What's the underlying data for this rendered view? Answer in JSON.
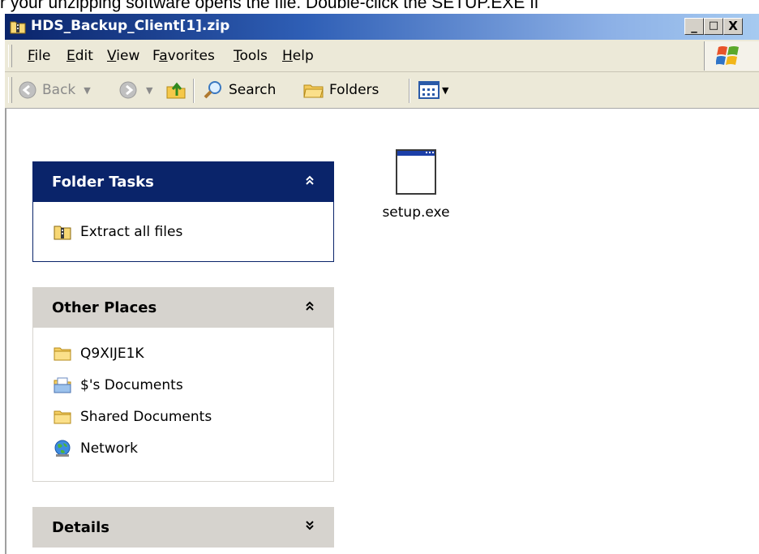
{
  "caption": "r your unzipping software opens the file. Double-click the SETUP.EXE fi",
  "window": {
    "title": "HDS_Backup_Client[1].zip",
    "controls": {
      "minimize": "_",
      "maximize": "□",
      "close": "X"
    }
  },
  "menu": {
    "items": [
      {
        "label": "File",
        "u": "F",
        "rest": "ile"
      },
      {
        "label": "Edit",
        "u": "E",
        "rest": "dit"
      },
      {
        "label": "View",
        "u": "V",
        "rest": "iew"
      },
      {
        "label": "Favorites",
        "pre": "F",
        "u": "a",
        "rest": "vorites"
      },
      {
        "label": "Tools",
        "u": "T",
        "rest": "ools"
      },
      {
        "label": "Help",
        "u": "H",
        "rest": "elp"
      }
    ]
  },
  "toolbar": {
    "back": "Back",
    "search": "Search",
    "folders": "Folders"
  },
  "folder_tasks": {
    "title": "Folder Tasks",
    "collapse_glyph": "⌃",
    "items": [
      "Extract all files"
    ]
  },
  "other_places": {
    "title": "Other Places",
    "collapse_glyph": "⌃",
    "items": [
      "Q9XIJE1K",
      "$'s Documents",
      "Shared Documents",
      "Network"
    ]
  },
  "details": {
    "title": "Details",
    "expand_glyph": "⌄"
  },
  "files": [
    {
      "name": "setup.exe"
    }
  ],
  "colors": {
    "title_start": "#0a246a",
    "title_end": "#a6caf0",
    "panel_blue": "#0a246a",
    "panel_grey": "#d6d3ce"
  }
}
